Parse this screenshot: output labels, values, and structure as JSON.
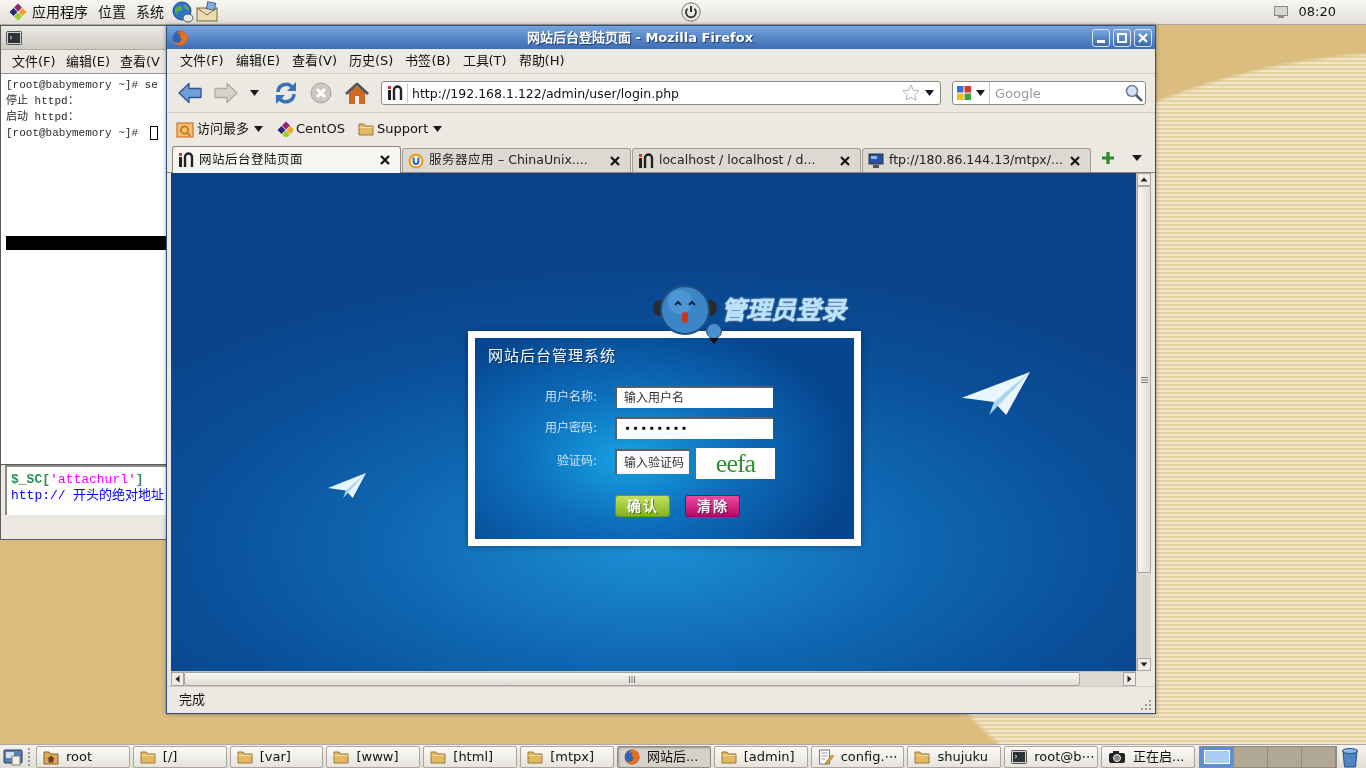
{
  "top_panel": {
    "menus": [
      "应用程序",
      "位置",
      "系统"
    ],
    "clock": "08:20"
  },
  "terminal": {
    "menus": [
      "文件(F)",
      "编辑(E)",
      "查看(V"
    ],
    "lines": [
      {
        "text": "[root@babymemory ~]# se",
        "cursor": false
      },
      {
        "text": "停止 httpd：",
        "cursor": false
      },
      {
        "text": "启动 httpd：",
        "cursor": false
      },
      {
        "text": "[root@babymemory ~]#",
        "cursor": true
      }
    ]
  },
  "editor": {
    "lines": [
      [
        {
          "text": "$_SC[",
          "kind": "variable"
        },
        {
          "text": "'attachurl'",
          "kind": "string"
        },
        {
          "text": "]",
          "kind": "variable"
        }
      ],
      [
        {
          "text": "http:// 开头的绝对地址",
          "kind": "comment"
        }
      ]
    ]
  },
  "browser": {
    "title": "网站后台登陆页面 - Mozilla Firefox",
    "menus": [
      "文件(F)",
      "编辑(E)",
      "查看(V)",
      "历史(S)",
      "书签(B)",
      "工具(T)",
      "帮助(H)"
    ],
    "nav_buttons": [
      {
        "kind": "back",
        "disabled": false
      },
      {
        "kind": "forward",
        "disabled": true
      },
      {
        "kind": "history",
        "disabled": false
      },
      {
        "kind": "reload",
        "disabled": false
      },
      {
        "kind": "stop",
        "disabled": true
      },
      {
        "kind": "home",
        "disabled": false
      }
    ],
    "url": "http://192.168.1.122/admin/user/login.php",
    "search": {
      "placeholder": "Google"
    },
    "bookmarks": [
      {
        "label": "访问最多",
        "kind": "smart"
      },
      {
        "label": "CentOS",
        "kind": "link"
      },
      {
        "label": "Support",
        "kind": "folder"
      }
    ],
    "tabs": [
      {
        "label": "网站后台登陆页面",
        "kind": "site",
        "selected": true
      },
      {
        "label": "服务器应用 – ChinaUnix....",
        "kind": "ring",
        "selected": false
      },
      {
        "label": "localhost / localhost / d...",
        "kind": "site",
        "selected": false
      },
      {
        "label": "ftp://180.86.144.13/mtpx/...",
        "kind": "monitor",
        "selected": false
      }
    ],
    "page": {
      "heading": "管理员登录",
      "panel_title": "网站后台管理系统",
      "fields": [
        {
          "kind": "text",
          "label": "用户名称:",
          "placeholder": "输入用户名"
        },
        {
          "kind": "password",
          "label": "用户密码:",
          "value": "••••••••"
        },
        {
          "kind": "captcha",
          "label": "验证码:",
          "placeholder": "输入验证码",
          "captcha": "eefa"
        }
      ],
      "buttons": [
        {
          "kind": "submit",
          "label": "确认"
        },
        {
          "kind": "reset",
          "label": "清除"
        }
      ]
    },
    "status": "完成"
  },
  "taskbar": {
    "items": [
      {
        "label": "root",
        "kind": "home",
        "selected": false
      },
      {
        "label": "[/]",
        "kind": "folder",
        "selected": false
      },
      {
        "label": "[var]",
        "kind": "folder",
        "selected": false
      },
      {
        "label": "[www]",
        "kind": "folder",
        "selected": false
      },
      {
        "label": "[html]",
        "kind": "folder",
        "selected": false
      },
      {
        "label": "[mtpx]",
        "kind": "folder",
        "selected": false
      },
      {
        "label": "网站后...",
        "kind": "browser",
        "selected": true
      },
      {
        "label": "[admin]",
        "kind": "folder",
        "selected": false
      },
      {
        "label": "config.⋯",
        "kind": "editor",
        "selected": false
      },
      {
        "label": "shujuku",
        "kind": "folder",
        "selected": false
      },
      {
        "label": "root@b⋯",
        "kind": "terminal",
        "selected": false
      },
      {
        "label": "正在启...",
        "kind": "camera",
        "selected": false
      }
    ],
    "workspaces": [
      {
        "selected": true
      },
      {
        "selected": false
      },
      {
        "selected": false
      },
      {
        "selected": false
      }
    ]
  }
}
